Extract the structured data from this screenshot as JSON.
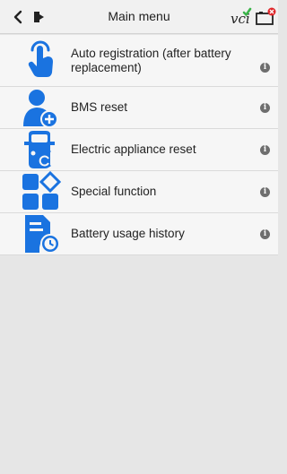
{
  "header": {
    "title": "Main menu"
  },
  "colors": {
    "accent": "#1a73e0",
    "vci_green": "#3bb54a",
    "alert_red": "#e0262a"
  },
  "menu": {
    "items": [
      {
        "label": "Auto registration (after battery replacement)",
        "icon": "hand-touch-icon"
      },
      {
        "label": "BMS reset",
        "icon": "person-add-icon"
      },
      {
        "label": "Electric appliance reset",
        "icon": "car-reset-icon"
      },
      {
        "label": "Special function",
        "icon": "grid-diamond-icon"
      },
      {
        "label": "Battery usage history",
        "icon": "document-clock-icon"
      }
    ],
    "info_glyph": "i"
  }
}
